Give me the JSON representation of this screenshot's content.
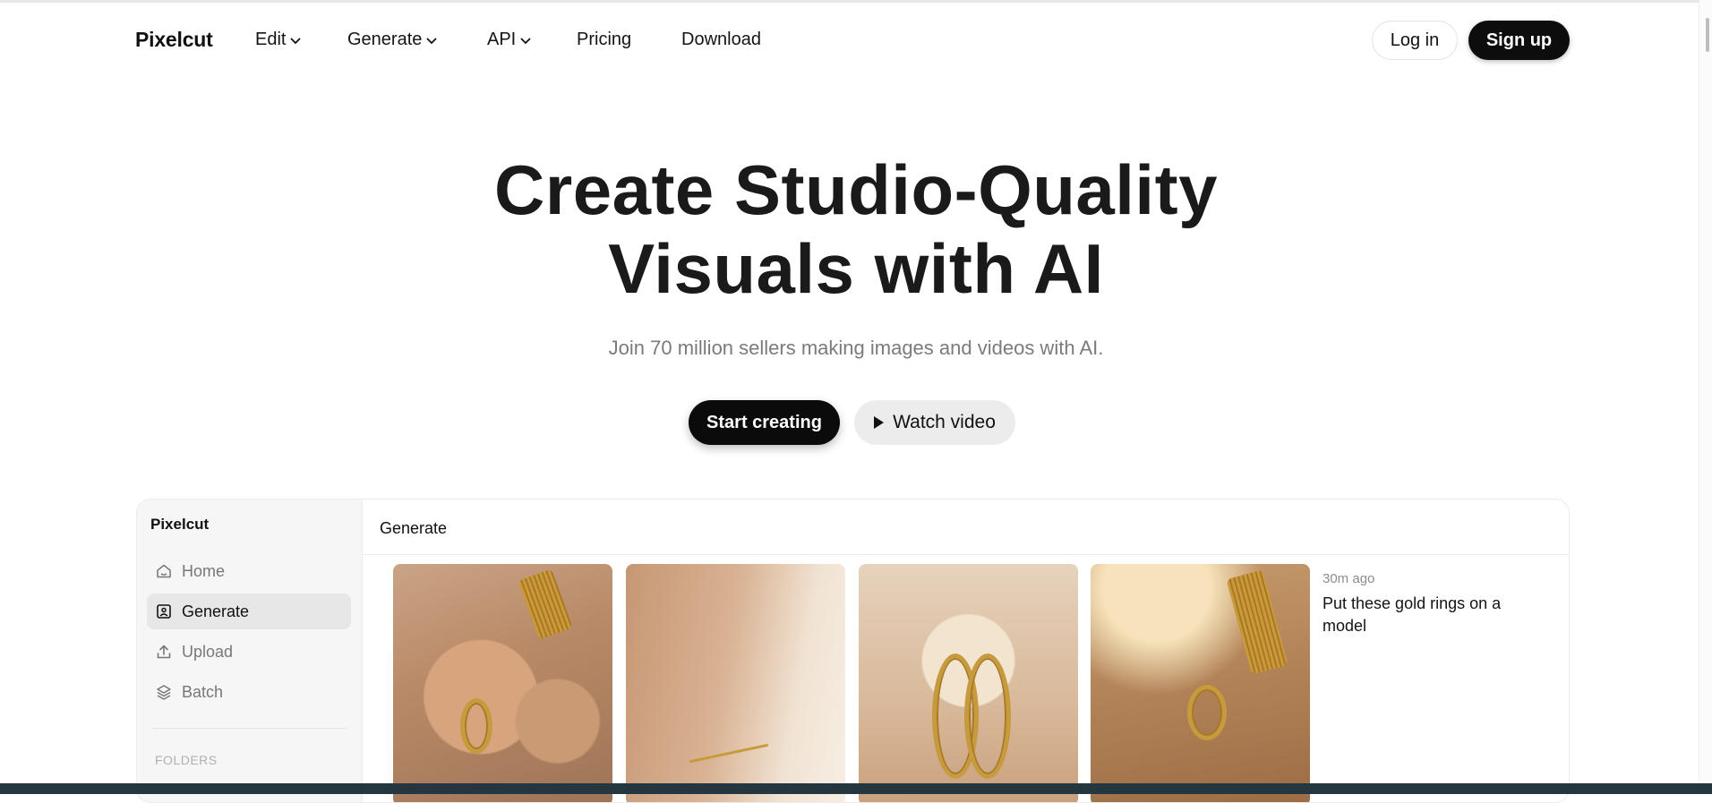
{
  "nav": {
    "brand": "Pixelcut",
    "items": [
      {
        "label": "Edit",
        "dropdown": true
      },
      {
        "label": "Generate",
        "dropdown": true
      },
      {
        "label": "API",
        "dropdown": true
      },
      {
        "label": "Pricing",
        "dropdown": false
      },
      {
        "label": "Download",
        "dropdown": false
      }
    ],
    "login_label": "Log in",
    "signup_label": "Sign up"
  },
  "hero": {
    "title_line1": "Create Studio-Quality",
    "title_line2": "Visuals with AI",
    "subtitle": "Join 70 million sellers making images and videos with AI.",
    "start_label": "Start creating",
    "watch_label": "Watch video"
  },
  "app": {
    "brand": "Pixelcut",
    "sidebar": [
      {
        "label": "Home",
        "icon": "home-icon",
        "active": false
      },
      {
        "label": "Generate",
        "icon": "image-icon",
        "active": true
      },
      {
        "label": "Upload",
        "icon": "upload-icon",
        "active": false
      },
      {
        "label": "Batch",
        "icon": "layers-icon",
        "active": false
      }
    ],
    "folders_label": "FOLDERS",
    "main_title": "Generate",
    "result": {
      "time": "30m ago",
      "prompt": "Put these gold rings on a model"
    }
  },
  "colors": {
    "primary_button": "#0d0d0d",
    "secondary_button": "#ececec",
    "subtitle_text": "#7b7b7b"
  }
}
